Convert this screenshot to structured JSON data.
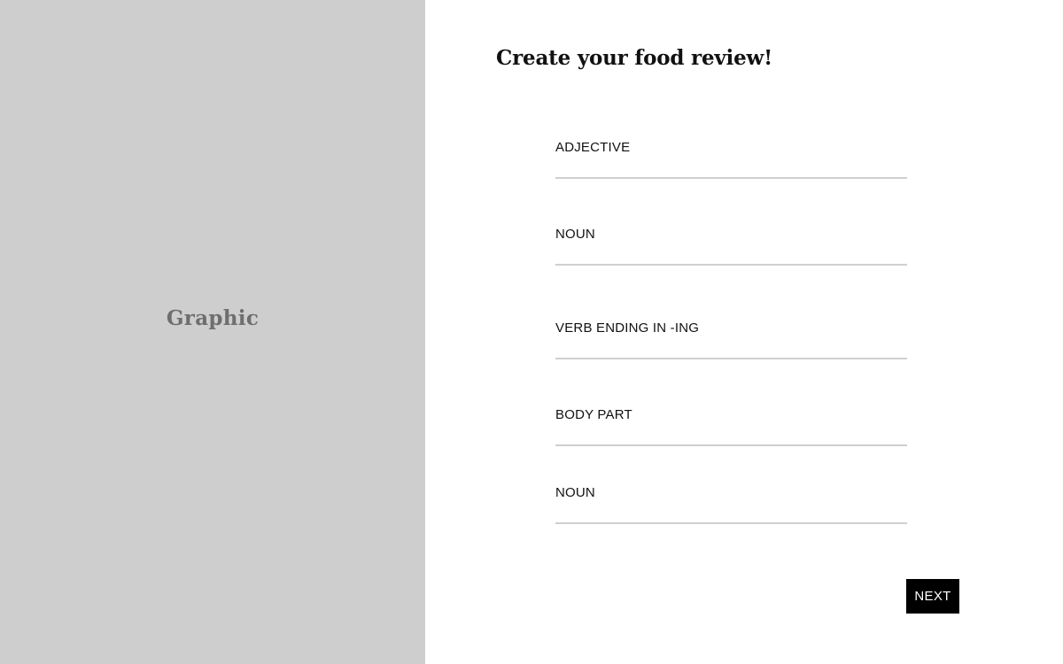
{
  "graphic": {
    "label": "Graphic"
  },
  "form": {
    "title": "Create your food review!",
    "fields": [
      {
        "placeholder": "ADJECTIVE",
        "value": ""
      },
      {
        "placeholder": "NOUN",
        "value": ""
      },
      {
        "placeholder": "VERB ENDING IN -ING",
        "value": ""
      },
      {
        "placeholder": "BODY PART",
        "value": ""
      },
      {
        "placeholder": "NOUN",
        "value": ""
      }
    ],
    "next_label": "NEXT"
  },
  "colors": {
    "graphic_panel_bg": "#cecece",
    "graphic_label": "#6e6e6e",
    "field_underline": "#cfcfcf",
    "button_bg": "#000000",
    "button_text": "#ffffff"
  }
}
